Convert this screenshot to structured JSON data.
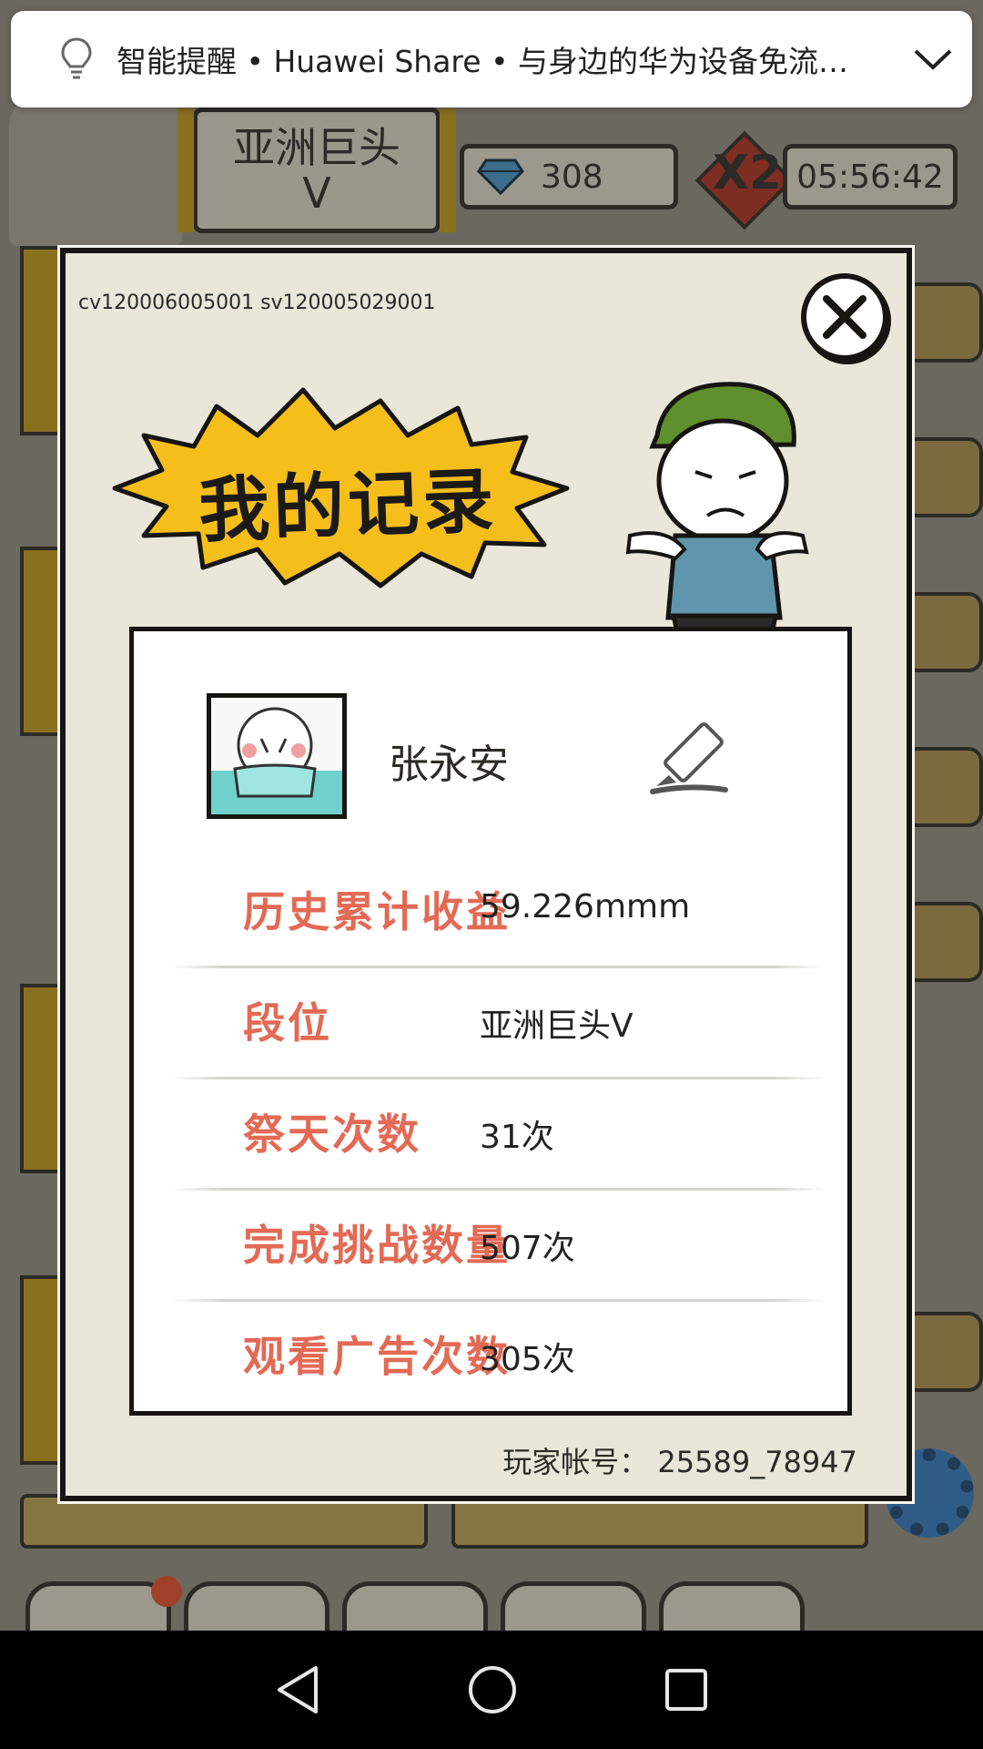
{
  "notification": {
    "text": "智能提醒 • Huawei Share • 与身边的华为设备免流…",
    "icon": "lightbulb-icon",
    "expand_icon": "chevron-down-icon"
  },
  "hud": {
    "rank_line1": "亚洲巨头",
    "rank_line2": "V",
    "gems": "308",
    "multiplier": "X2",
    "timer": "05:56:42"
  },
  "dialog": {
    "version": "cv120006005001 sv120005029001",
    "title": "我的记录",
    "player_name": "张永安",
    "stats": [
      {
        "label": "历史累计收益",
        "value": "59.226mmm"
      },
      {
        "label": "段位",
        "value": "亚洲巨头V"
      },
      {
        "label": "祭天次数",
        "value": "31次"
      },
      {
        "label": "完成挑战数量",
        "value": "507次"
      },
      {
        "label": "观看广告次数",
        "value": "305次"
      }
    ],
    "account": "玩家帐号： 25589_78947"
  },
  "colors": {
    "label_red": "#e36a55",
    "burst_yellow": "#f6be1b",
    "dialog_bg": "#eae6d9"
  }
}
